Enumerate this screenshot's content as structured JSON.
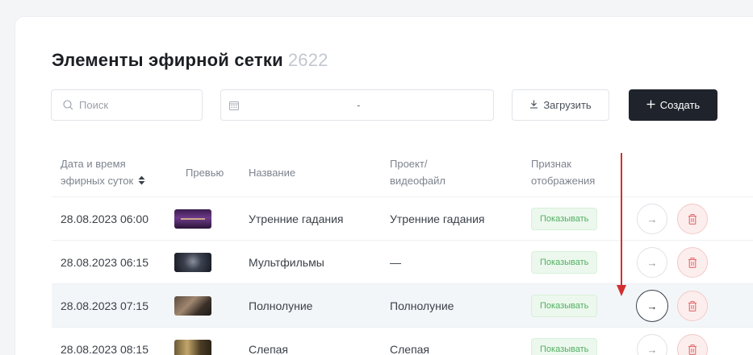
{
  "header": {
    "title": "Элементы эфирной сетки",
    "count": "2622"
  },
  "toolbar": {
    "search_placeholder": "Поиск",
    "date_separator": "-",
    "upload_label": "Загрузить",
    "create_label": "Создать"
  },
  "table": {
    "columns": {
      "date_line1": "Дата и время",
      "date_line2": "эфирных суток",
      "preview": "Превью",
      "name": "Название",
      "project_line1": "Проект/",
      "project_line2": "видеофайл",
      "sign_line1": "Признак",
      "sign_line2": "отображения"
    },
    "rows": [
      {
        "date": "28.08.2023 06:00",
        "name": "Утренние гадания",
        "project": "Утренние гадания",
        "sign": "Показывать"
      },
      {
        "date": "28.08.2023 06:15",
        "name": "Мультфильмы",
        "project": "—",
        "sign": "Показывать"
      },
      {
        "date": "28.08.2023 07:15",
        "name": "Полнолуние",
        "project": "Полнолуние",
        "sign": "Показывать"
      },
      {
        "date": "28.08.2023 08:15",
        "name": "Слепая",
        "project": "Слепая",
        "sign": "Показывать"
      }
    ]
  },
  "colors": {
    "accent_dark": "#1f242c",
    "badge_text": "#52b063",
    "badge_bg": "#ecf8ed",
    "delete_red": "#e26b6b",
    "annotation_red": "#d32f2f"
  },
  "icons": {
    "search": "search-icon",
    "calendar": "calendar-icon",
    "upload": "download-icon",
    "create": "plus-icon",
    "sort": "sort-icon",
    "go": "arrow-right-icon",
    "delete": "trash-icon"
  }
}
